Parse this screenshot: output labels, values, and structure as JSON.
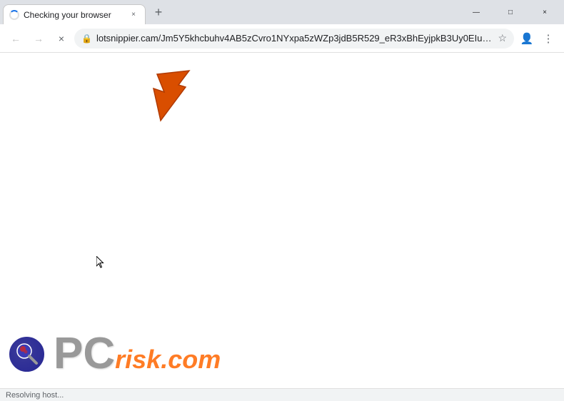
{
  "titlebar": {
    "tab": {
      "title": "Checking your browser",
      "close_label": "×"
    },
    "new_tab_label": "+",
    "window_controls": {
      "minimize": "—",
      "maximize": "□",
      "close": "×"
    }
  },
  "navbar": {
    "back_label": "←",
    "forward_label": "→",
    "close_loading_label": "×",
    "address": "lotsnippier.cam/Jm5Y5khcbuhv4AB5zCvro1NYxpa5zWZp3jdB5R529_eR3xBhEyjpkB3Uy0EIueO6ekIDj*1ljKFzPjLZhaK16Fc9...",
    "star_label": "☆",
    "profile_label": "⊙",
    "menu_label": "⋮"
  },
  "statusbar": {
    "text": "Resolving host..."
  },
  "pcrisk": {
    "pc_text": "PC",
    "risk_text": "risk.com"
  },
  "arrow": {
    "color": "#d94e00"
  }
}
